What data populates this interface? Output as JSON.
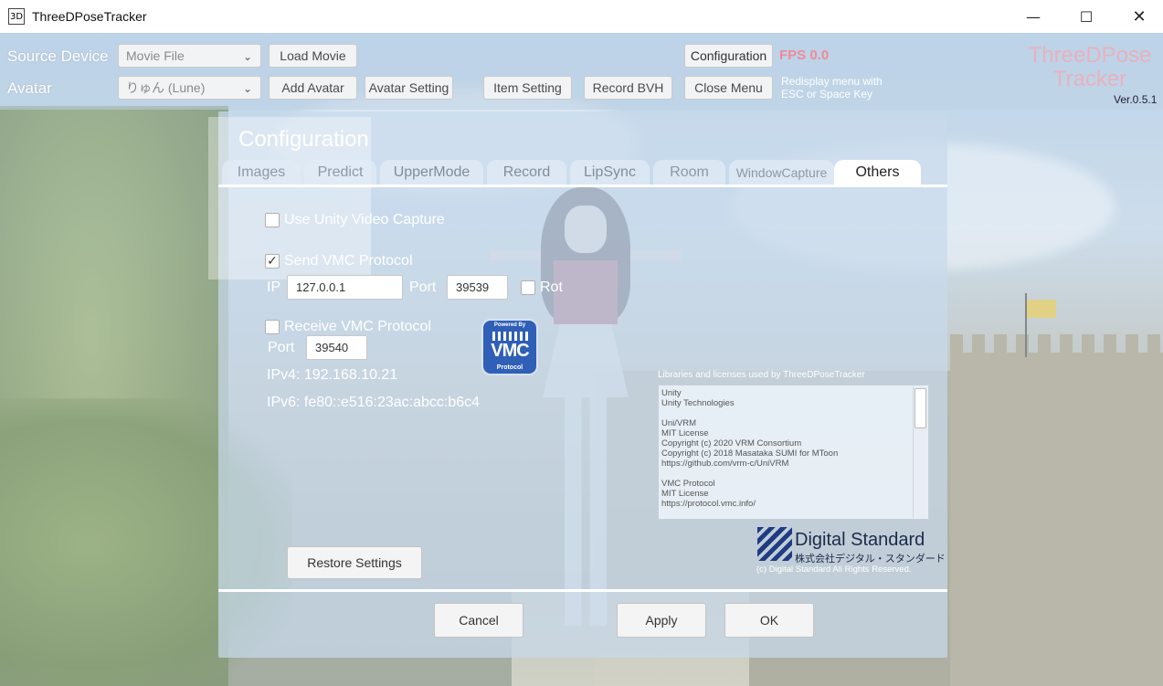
{
  "window": {
    "title": "ThreeDPoseTracker",
    "icon_glyph": "3D"
  },
  "window_controls": {
    "minimize": "—",
    "maximize": "☐",
    "close": "✕"
  },
  "menu": {
    "source_device_label": "Source Device",
    "source_device_value": "Movie File",
    "load_movie": "Load Movie",
    "avatar_label": "Avatar",
    "avatar_value": "りゅん (Lune)",
    "add_avatar": "Add Avatar",
    "avatar_setting": "Avatar Setting",
    "item_setting": "Item Setting",
    "record_bvh": "Record BVH",
    "configuration": "Configuration",
    "close_menu": "Close Menu",
    "fps": "FPS 0.0",
    "hint_line1": "Redisplay menu with",
    "hint_line2": "ESC or Space Key",
    "brand_line1": "ThreeDPose",
    "brand_line2": "Tracker",
    "version": "Ver.0.5.1"
  },
  "config": {
    "title": "Configuration",
    "tabs": [
      {
        "label": "Images"
      },
      {
        "label": "Predict"
      },
      {
        "label": "UpperMode"
      },
      {
        "label": "Record"
      },
      {
        "label": "LipSync"
      },
      {
        "label": "Room"
      },
      {
        "label": "WindowCapture"
      },
      {
        "label": "Others"
      }
    ],
    "active_tab": "Others",
    "use_unity_video_capture": {
      "label": "Use Unity Video Capture",
      "checked": false
    },
    "send_vmc": {
      "label": "Send VMC Protocol",
      "checked": true
    },
    "ip_label": "IP",
    "ip_value": "127.0.0.1",
    "send_port_label": "Port",
    "send_port_value": "39539",
    "rot": {
      "label": "Rot",
      "checked": false
    },
    "receive_vmc": {
      "label": "Receive VMC Protocol",
      "checked": false
    },
    "receive_port_label": "Port",
    "receive_port_value": "39540",
    "ipv4": "IPv4: 192.168.10.21",
    "ipv6": "IPv6: fe80::e516:23ac:abcc:b6c4",
    "vmc_logo": {
      "powered": "Powered By",
      "name": "VMC",
      "protocol": "Protocol"
    },
    "licenses_title": "Libraries and licenses used by ThreeDPoseTracker",
    "licenses_text": "Unity\nUnity Technologies\n\nUni/VRM\nMIT License\nCopyright (c) 2020 VRM Consortium\nCopyright (c) 2018 Masataka SUMI for MToon\nhttps://github.com/vrm-c/UniVRM\n\nVMC Protocol\nMIT License\nhttps://protocol.vmc.info/",
    "company_name": "Digital Standard",
    "company_jp": "株式会社デジタル・スタンダード",
    "company_copy": "(c) Digital Standard All Rights Reserved.",
    "restore_settings": "Restore Settings",
    "cancel": "Cancel",
    "apply": "Apply",
    "ok": "OK"
  },
  "colors": {
    "fps": "#f08a98",
    "brand": "#f3a9b4",
    "panel": "#c8daeb",
    "vmc_blue": "#2f5fb6"
  }
}
